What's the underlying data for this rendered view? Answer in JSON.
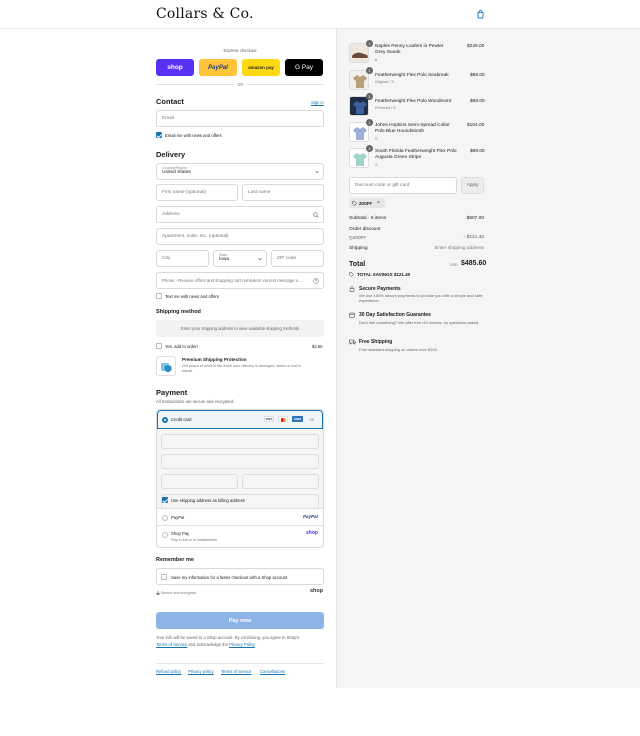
{
  "brand": "Collars & Co.",
  "express": {
    "title": "Express checkout",
    "shop": "shop",
    "paypal": "PayPal",
    "amazon": "amazon pay",
    "gpay": "G Pay",
    "or": "OR"
  },
  "contact": {
    "heading": "Contact",
    "signin": "Sign in",
    "email_placeholder": "Email",
    "news_label": "Email me with news and offers"
  },
  "delivery": {
    "heading": "Delivery",
    "country_label": "Country/Region",
    "country_value": "United States",
    "first_name": "First name (optional)",
    "last_name": "Last name",
    "address": "Address",
    "apartment": "Apartment, suite, etc. (optional)",
    "city": "City",
    "state_label": "State",
    "state_value": "Iowa",
    "zip": "ZIP code",
    "phone": "Phone - Receive offers and shopping cart reminders via text message o...",
    "text_news": "Text me with news and offers"
  },
  "shipping": {
    "heading": "Shipping method",
    "placeholder": "Enter your shipping address to view available shipping methods",
    "addon_label": "Yes, add to order!",
    "addon_price": "$2.50",
    "protection_title": "Premium Shipping Protection",
    "protection_desc": "Get peace of mind in the event your delivery is damaged, stolen or lost in transit."
  },
  "payment": {
    "heading": "Payment",
    "subtitle": "All transactions are secure and encrypted.",
    "credit_card": "Credit card",
    "card_more": "+3",
    "card_visa": "VISA",
    "card_amex": "AMEX",
    "billing_same": "Use shipping address as billing address",
    "paypal": "PayPal",
    "paypal_logo": "PayPal",
    "shoppay": "Shop Pay",
    "shoppay_sub": "Pay in full or in installments",
    "shoppay_logo": "shop"
  },
  "remember": {
    "heading": "Remember me",
    "label": "Save my information for a faster checkout with a Shop account",
    "secure": "Secure and encrypted",
    "shop_logo": "shop"
  },
  "pay_button": "Pay now",
  "legal": {
    "line1": "Your info will be saved to a Shop account. By continuing, you agree to Shop's",
    "tos": "Terms of Service",
    "and": " and acknowledge the ",
    "privacy": "Privacy Policy",
    "end": "."
  },
  "footer_links": [
    "Refund policy",
    "Privacy policy",
    "Terms of service",
    "Cancellations"
  ],
  "items": [
    {
      "name": "Naples Penny Loafers in Pewter Grey Suede",
      "variant": "8",
      "price": "$228.00",
      "qty": "1"
    },
    {
      "name": "Featherweight Flex Polo Seabreak",
      "variant": "Original / S",
      "price": "$88.00",
      "qty": "1"
    },
    {
      "name": "Featherweight Flex Polo Woodmont",
      "variant": "Preloved / S",
      "price": "$88.00",
      "qty": "1"
    },
    {
      "name": "Johns Hopkins Semi-Spread Collar Polo Blue Houndstooth",
      "variant": "S",
      "price": "$104.00",
      "qty": "1"
    },
    {
      "name": "South Florida Featherweight Flex Polo Augusta Green Stripe",
      "variant": "S",
      "price": "$99.00",
      "qty": "1"
    }
  ],
  "discount": {
    "placeholder": "Discount code or gift card",
    "apply": "Apply",
    "code": "20OFF"
  },
  "summary": {
    "subtotal_label": "Subtotal · 5 items",
    "subtotal": "$607.00",
    "order_discount": "Order discount",
    "code": "20OFF",
    "discount_amount": "- $121.40",
    "shipping_label": "Shipping",
    "shipping_value": "Enter shipping address",
    "total_label": "Total",
    "currency": "USD",
    "total": "$485.60",
    "savings": "TOTAL SAVINGS $121.40"
  },
  "perks": [
    {
      "title": "Secure Payments",
      "desc": "We use 100% secure payments to provide you with a simple and safe experience."
    },
    {
      "title": "30 Day Satisfaction Guarantee",
      "desc": "Don't like something? We offer free US returns, no questions asked."
    },
    {
      "title": "Free Shipping",
      "desc": "Free standard shipping on orders over $100"
    }
  ]
}
